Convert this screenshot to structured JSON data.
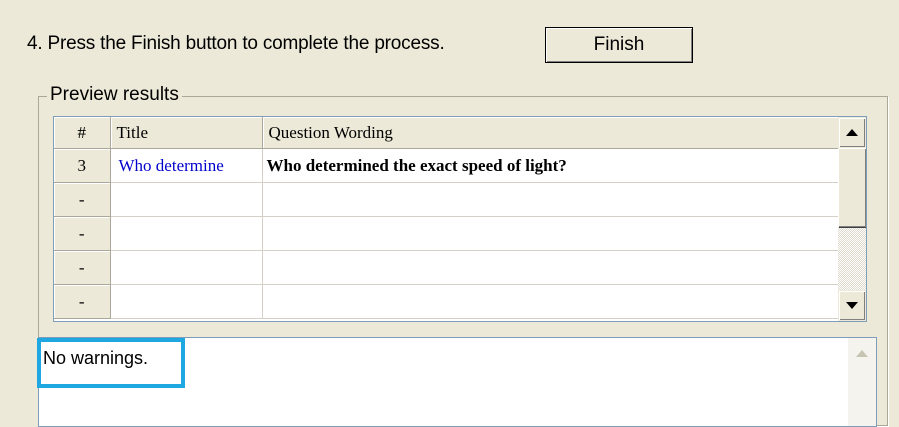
{
  "step": {
    "text": "4.  Press the Finish button to complete the process."
  },
  "finish_button": {
    "label": "Finish"
  },
  "preview": {
    "legend": "Preview results",
    "columns": {
      "num": "#",
      "title": "Title",
      "wording": "Question Wording"
    },
    "rows": [
      {
        "num": "3",
        "title": "Who determine",
        "wording": "Who determined the exact speed of light?"
      },
      {
        "num": "-",
        "title": "",
        "wording": ""
      },
      {
        "num": "-",
        "title": "",
        "wording": ""
      },
      {
        "num": "-",
        "title": "",
        "wording": ""
      },
      {
        "num": "-",
        "title": "",
        "wording": ""
      }
    ]
  },
  "warnings": {
    "text": "No warnings."
  },
  "colors": {
    "highlight": "#1ea7e1",
    "title_link": "#0000cc"
  }
}
